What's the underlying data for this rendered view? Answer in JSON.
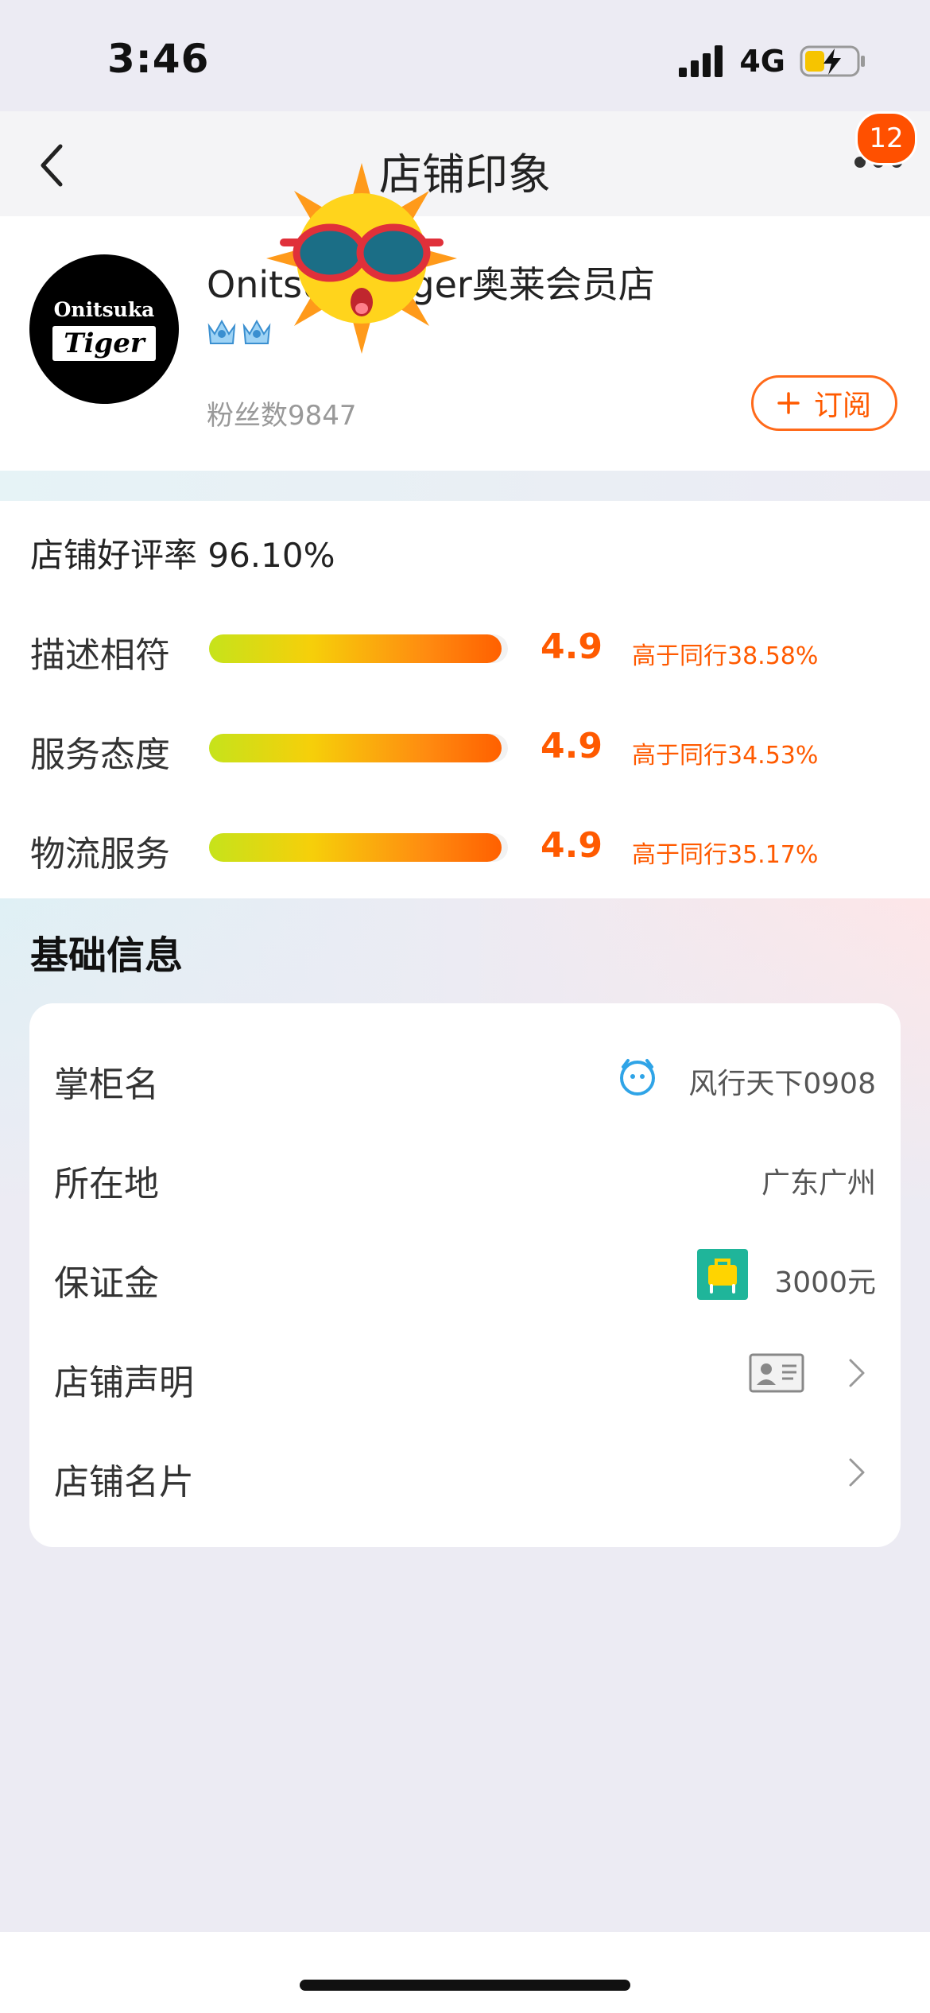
{
  "status_bar": {
    "time": "3:46",
    "network": "4G"
  },
  "nav": {
    "title": "店铺印象",
    "badge_count": "12"
  },
  "shop": {
    "logo_text_top": "Onitsuka",
    "logo_text_bottom": "Tiger",
    "name": "Onitsuka Tiger奥莱会员店",
    "fans": "粉丝数9847",
    "subscribe_label": "订阅",
    "crown_count": 2
  },
  "rating": {
    "title": "店铺好评率 96.10%",
    "rows": [
      {
        "label": "描述相符",
        "score": "4.9",
        "compare": "高于同行38.58%",
        "fill": 0.98
      },
      {
        "label": "服务态度",
        "score": "4.9",
        "compare": "高于同行34.53%",
        "fill": 0.98
      },
      {
        "label": "物流服务",
        "score": "4.9",
        "compare": "高于同行35.17%",
        "fill": 0.98
      }
    ]
  },
  "basic_info": {
    "title": "基础信息",
    "items": [
      {
        "label": "掌柜名",
        "value": "风行天下0908",
        "icon": "wangwang-icon"
      },
      {
        "label": "所在地",
        "value": "广东广州"
      },
      {
        "label": "保证金",
        "value": "3000元",
        "icon": "deposit-icon"
      },
      {
        "label": "店铺声明",
        "value": "",
        "icon": "license-card-icon"
      },
      {
        "label": "店铺名片",
        "value": ""
      }
    ]
  },
  "colors": {
    "accent": "#ff5a00",
    "badge": "#ff5000"
  }
}
